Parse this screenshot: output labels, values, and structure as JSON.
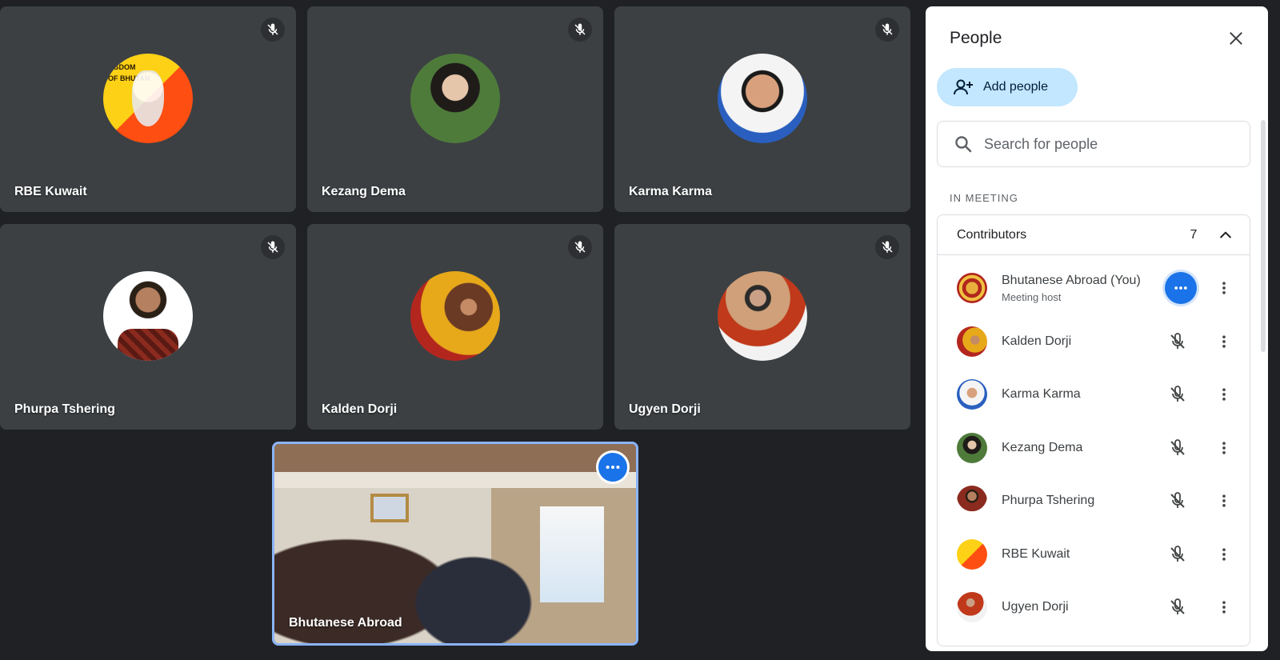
{
  "tiles": [
    {
      "name": "RBE Kuwait",
      "avatar_text": "NGDOM\nOF BHUTAN"
    },
    {
      "name": "Kezang Dema"
    },
    {
      "name": "Karma Karma"
    },
    {
      "name": "Phurpa Tshering"
    },
    {
      "name": "Kalden Dorji"
    },
    {
      "name": "Ugyen Dorji"
    }
  ],
  "self_tile": {
    "name": "Bhutanese Abroad",
    "options_icon": "more-horiz-icon"
  },
  "panel": {
    "title": "People",
    "add_people_label": "Add people",
    "search_placeholder": "Search for people",
    "section_label": "IN MEETING",
    "group": {
      "title": "Contributors",
      "count": "7"
    },
    "participants": [
      {
        "name": "Bhutanese Abroad (You)",
        "sub": "Meeting host",
        "icon": "more-horiz-icon"
      },
      {
        "name": "Kalden Dorji",
        "icon": "mic-off-icon"
      },
      {
        "name": "Karma Karma",
        "icon": "mic-off-icon"
      },
      {
        "name": "Kezang Dema",
        "icon": "mic-off-icon"
      },
      {
        "name": "Phurpa Tshering",
        "icon": "mic-off-icon"
      },
      {
        "name": "RBE Kuwait",
        "icon": "mic-off-icon"
      },
      {
        "name": "Ugyen Dorji",
        "icon": "mic-off-icon"
      }
    ]
  },
  "colors": {
    "background": "#202124",
    "tile": "#3c4043",
    "accent": "#1a73e8",
    "add_button": "#c2e7ff",
    "self_border": "#8ab4f8"
  }
}
